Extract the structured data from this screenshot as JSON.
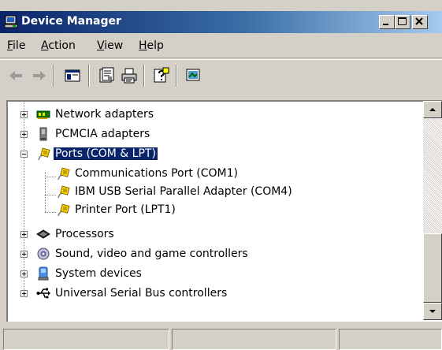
{
  "window": {
    "title": "Device Manager",
    "icon": "device-manager-icon",
    "buttons": [
      "minimize-icon",
      "maximize-icon",
      "close-icon"
    ]
  },
  "menubar": {
    "items": [
      {
        "label": "File",
        "accel": "F",
        "rest": "ile"
      },
      {
        "label": "Action",
        "accel": "A",
        "rest": "ction"
      },
      {
        "label": "View",
        "accel": "V",
        "rest": "iew"
      },
      {
        "label": "Help",
        "accel": "H",
        "rest": "elp"
      }
    ]
  },
  "toolbar": {
    "buttons": [
      "back-arrow-icon",
      "forward-arrow-icon",
      "show-hide-console-tree-icon",
      "properties-icon",
      "print-icon",
      "help-icon",
      "device-manager-view-icon"
    ]
  },
  "tree": {
    "items": [
      {
        "label": "Network adapters",
        "icon": "network-adapter-icon",
        "expander": "plus"
      },
      {
        "label": "PCMCIA adapters",
        "icon": "pcmcia-icon",
        "expander": "plus"
      },
      {
        "label": "Ports (COM & LPT)",
        "icon": "port-connector-icon",
        "expander": "minus",
        "selected": true
      },
      {
        "label": "Communications Port (COM1)",
        "icon": "port-connector-icon",
        "child": true
      },
      {
        "label": "IBM USB Serial Parallel Adapter (COM4)",
        "icon": "port-connector-icon",
        "child": true
      },
      {
        "label": "Printer Port (LPT1)",
        "icon": "port-connector-icon",
        "child": true
      },
      {
        "label": "Processors",
        "icon": "processor-icon",
        "expander": "plus"
      },
      {
        "label": "Sound, video and game controllers",
        "icon": "speaker-icon",
        "expander": "plus"
      },
      {
        "label": "System devices",
        "icon": "system-device-icon",
        "expander": "plus"
      },
      {
        "label": "Universal Serial Bus controllers",
        "icon": "usb-icon",
        "expander": "plus"
      }
    ]
  },
  "scrollbar": {
    "position_fraction": 0.85
  },
  "statusbar": {
    "panes": [
      "",
      "",
      ""
    ]
  }
}
